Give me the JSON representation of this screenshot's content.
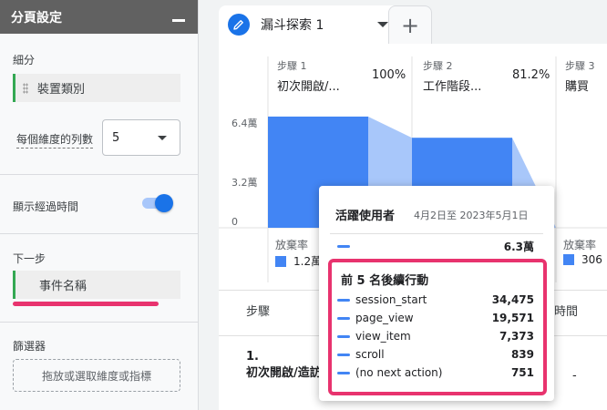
{
  "panel": {
    "title": "分頁設定",
    "breakdown_label": "細分",
    "breakdown_chip": "裝置類別",
    "rows_label": "每個維度的列數",
    "rows_value": "5",
    "elapsed_label": "顯示經過時間",
    "elapsed_on": true,
    "next_step_label": "下一步",
    "next_step_chip": "事件名稱",
    "filter_label": "篩選器",
    "filter_placeholder": "拖放或選取維度或指標"
  },
  "tabs": [
    {
      "label": "漏斗探索 1"
    }
  ],
  "add_tab_label": "+",
  "chart_data": {
    "type": "bar",
    "categories": [
      "初次開啟/...",
      "工作階段...",
      "購買"
    ],
    "step_numbers": [
      "步驟 1",
      "步驟 2",
      "步驟 3"
    ],
    "completion_pct": [
      "100%",
      "81.2%",
      ""
    ],
    "values": [
      6.3,
      5.1,
      0
    ],
    "unit": "萬",
    "y_ticks": [
      "6.4萬",
      "3.2萬",
      "0"
    ],
    "ylim": [
      0,
      6.4
    ],
    "abandon_label": "放棄率",
    "abandon_values": [
      "1.2萬",
      "",
      "306"
    ],
    "colors": {
      "bar": "#4285f4",
      "flow": "#a8c7fa"
    }
  },
  "table": {
    "header_step": "步驟",
    "header_time": "時間",
    "row1_index": "1.",
    "row1_name": "初次開啟/造訪",
    "row1_time": "-"
  },
  "tooltip": {
    "title": "活躍使用者",
    "date_range": "4月2日至 2023年5月1日",
    "total": "6.3萬",
    "next_actions_title": "前 5 名後續行動",
    "next_actions": [
      {
        "name": "session_start",
        "value": "34,475"
      },
      {
        "name": "page_view",
        "value": "19,571"
      },
      {
        "name": "view_item",
        "value": "7,373"
      },
      {
        "name": "scroll",
        "value": "839"
      },
      {
        "name": "(no next action)",
        "value": "751"
      }
    ]
  },
  "icons": {
    "pencil": "pencil-icon",
    "caret": "chevron-down-icon",
    "grip": "drag-handle-icon"
  }
}
